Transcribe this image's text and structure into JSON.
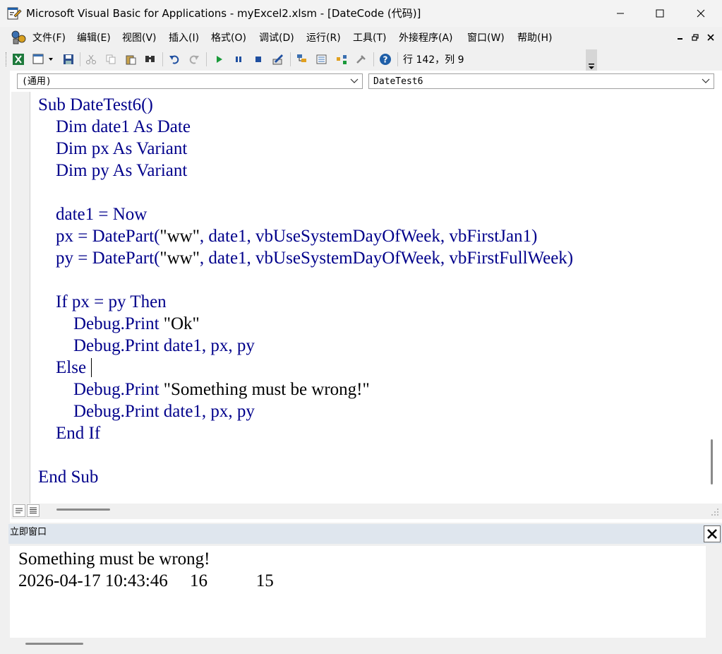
{
  "window": {
    "title": "Microsoft Visual Basic for Applications - myExcel2.xlsm - [DateCode (代码)]"
  },
  "menu": {
    "items": [
      "文件(F)",
      "编辑(E)",
      "视图(V)",
      "插入(I)",
      "格式(O)",
      "调试(D)",
      "运行(R)",
      "工具(T)",
      "外接程序(A)",
      "窗口(W)",
      "帮助(H)"
    ]
  },
  "toolbar": {
    "position": "行 142，列 9",
    "icons": [
      "excel-icon",
      "insert-module-icon",
      "save-icon",
      "cut-icon",
      "copy-icon",
      "paste-icon",
      "find-icon",
      "undo-icon",
      "redo-icon",
      "run-icon",
      "break-icon",
      "reset-icon",
      "design-mode-icon",
      "project-explorer-icon",
      "properties-icon",
      "object-browser-icon",
      "toolbox-icon",
      "help-icon"
    ]
  },
  "code_window": {
    "object_combo": "(通用)",
    "procedure_combo": "DateTest6",
    "lines": [
      "Sub DateTest6()",
      "    Dim date1 As Date",
      "    Dim px As Variant",
      "    Dim py As Variant",
      "",
      "    date1 = Now",
      "    px = DatePart(\"ww\", date1, vbUseSystemDayOfWeek, vbFirstJan1)",
      "    py = DatePart(\"ww\", date1, vbUseSystemDayOfWeek, vbFirstFullWeek)",
      "",
      "    If px = py Then",
      "        Debug.Print \"Ok\"",
      "        Debug.Print date1, px, py",
      "    Else",
      "        Debug.Print \"Something must be wrong!\"",
      "        Debug.Print date1, px, py",
      "    End If",
      "",
      "End Sub"
    ]
  },
  "immediate_window": {
    "title": "立即窗口",
    "lines": [
      "Something must be wrong!",
      "2026-04-17 10:43:46     16           15"
    ]
  },
  "colors": {
    "code_text": "#00008b",
    "string_text": "#000000",
    "immediate_title_bg": "#dfe6ee"
  }
}
